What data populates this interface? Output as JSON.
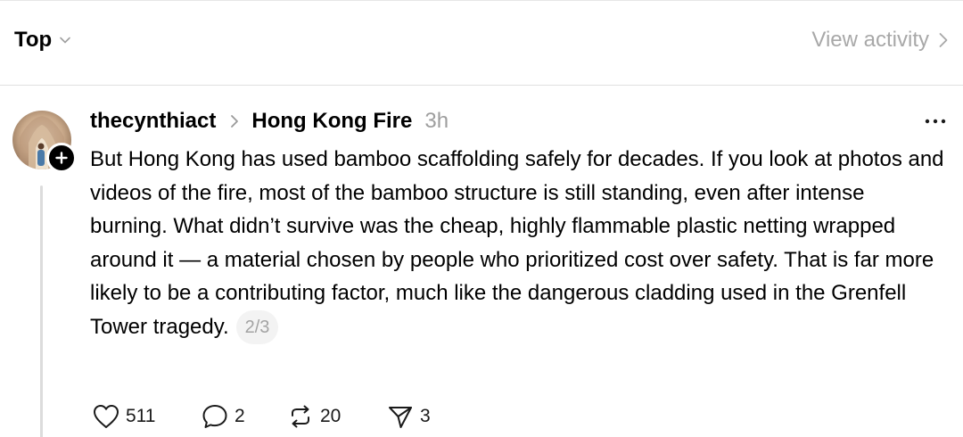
{
  "feed_header": {
    "sort_label": "Top",
    "view_activity_label": "View activity"
  },
  "post": {
    "username": "thecynthiact",
    "topic": "Hong Kong Fire",
    "time": "3h",
    "body": "But Hong Kong has used bamboo scaffolding safely for decades. If you look at photos and videos of the fire, most of the bamboo structure is still standing, even after intense burning. What didn’t survive was the cheap, highly flammable plastic netting wrapped around it — a material chosen by people who prioritized cost over safety. That is far more likely to be a contributing factor, much like the dangerous cladding used in the Grenfell Tower tragedy.",
    "page_indicator": "2/3",
    "stats": {
      "likes": "511",
      "replies": "2",
      "reposts": "20",
      "shares": "3"
    }
  },
  "icons": {
    "sort": "chevron-down-icon",
    "view_activity": "chevron-right-icon",
    "breadcrumb": "chevron-right-icon",
    "follow": "plus-icon",
    "menu": "more-horizontal-icon",
    "like": "heart-icon",
    "reply": "comment-icon",
    "repost": "repost-icon",
    "share": "send-icon"
  }
}
